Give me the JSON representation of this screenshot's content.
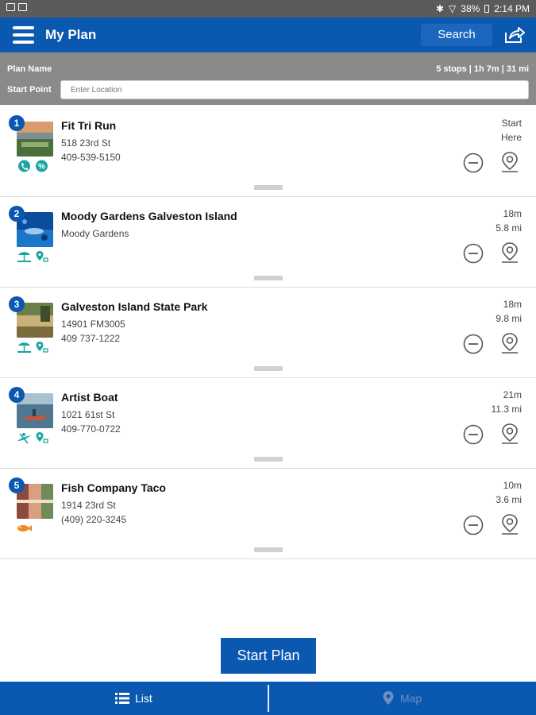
{
  "status_bar": {
    "battery": "38%",
    "time": "2:14 PM"
  },
  "header": {
    "title": "My Plan",
    "search_label": "Search"
  },
  "plan": {
    "name_label": "Plan Name",
    "stats": "5 stops | 1h 7m | 31 mi",
    "start_point_label": "Start Point",
    "start_point_placeholder": "Enter Location"
  },
  "stops": [
    {
      "number": "1",
      "name": "Fit Tri Run",
      "line1": "518 23rd St",
      "line2": "409-539-5150",
      "time": "Start",
      "distance": "Here"
    },
    {
      "number": "2",
      "name": "Moody Gardens Galveston Island",
      "line1": "Moody Gardens",
      "line2": "",
      "time": "18m",
      "distance": "5.8 mi"
    },
    {
      "number": "3",
      "name": "Galveston Island State Park",
      "line1": "14901 FM3005",
      "line2": "409 737-1222",
      "time": "18m",
      "distance": "9.8 mi"
    },
    {
      "number": "4",
      "name": "Artist Boat",
      "line1": "1021 61st St",
      "line2": "409-770-0722",
      "time": "21m",
      "distance": "11.3 mi"
    },
    {
      "number": "5",
      "name": "Fish Company Taco",
      "line1": "1914 23rd St",
      "line2": "(409) 220-3245",
      "time": "10m",
      "distance": "3.6 mi"
    }
  ],
  "start_button": "Start Plan",
  "bottom_nav": {
    "list_label": "List",
    "map_label": "Map"
  },
  "colors": {
    "primary": "#0b58b0",
    "amenity_teal": "#1aa6a0",
    "amenity_orange": "#f08a1c",
    "plan_bar": "#8a8a8a"
  }
}
